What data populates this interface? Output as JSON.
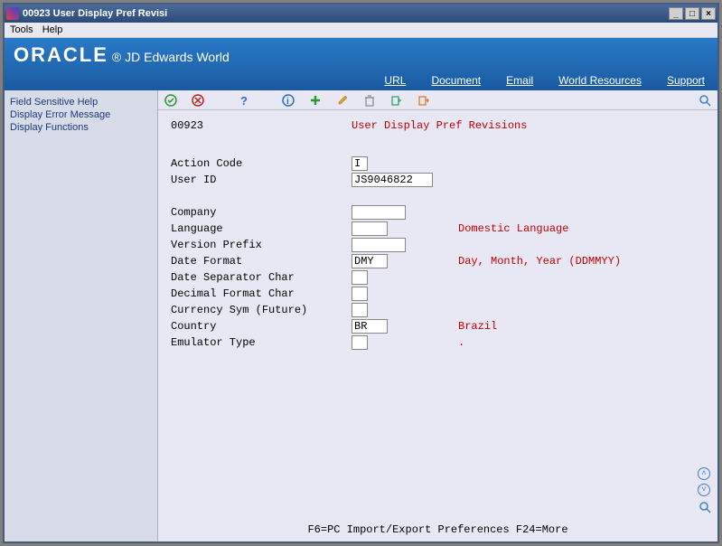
{
  "window": {
    "title": "00923   User Display Pref Revisi"
  },
  "menubar": {
    "tools": "Tools",
    "help": "Help"
  },
  "banner": {
    "logo": "ORACLE",
    "sub": "JD Edwards World",
    "links": {
      "url": "URL",
      "document": "Document",
      "email": "Email",
      "resources": "World Resources",
      "support": "Support"
    }
  },
  "sidebar": {
    "items": [
      "Field Sensitive Help",
      "Display Error Message",
      "Display Functions"
    ]
  },
  "page": {
    "code": "00923",
    "title": "User Display Pref Revisions"
  },
  "fields": {
    "action_code": {
      "label": "Action Code",
      "value": "I"
    },
    "user_id": {
      "label": "User ID",
      "value": "JS9046822"
    },
    "company": {
      "label": "Company",
      "value": ""
    },
    "language": {
      "label": "Language",
      "value": "",
      "desc": "Domestic Language"
    },
    "version_prefix": {
      "label": "Version Prefix",
      "value": ""
    },
    "date_format": {
      "label": "Date Format",
      "value": "DMY",
      "desc": "Day, Month, Year (DDMMYY)"
    },
    "date_sep": {
      "label": "Date Separator Char",
      "value": ""
    },
    "decimal_fmt": {
      "label": "Decimal Format Char",
      "value": ""
    },
    "currency_sym": {
      "label": "Currency Sym (Future)",
      "value": ""
    },
    "country": {
      "label": "Country",
      "value": "BR",
      "desc": "Brazil"
    },
    "emulator_type": {
      "label": "Emulator Type",
      "value": "",
      "desc": "."
    }
  },
  "footer": {
    "hint": "F6=PC Import/Export Preferences     F24=More"
  }
}
